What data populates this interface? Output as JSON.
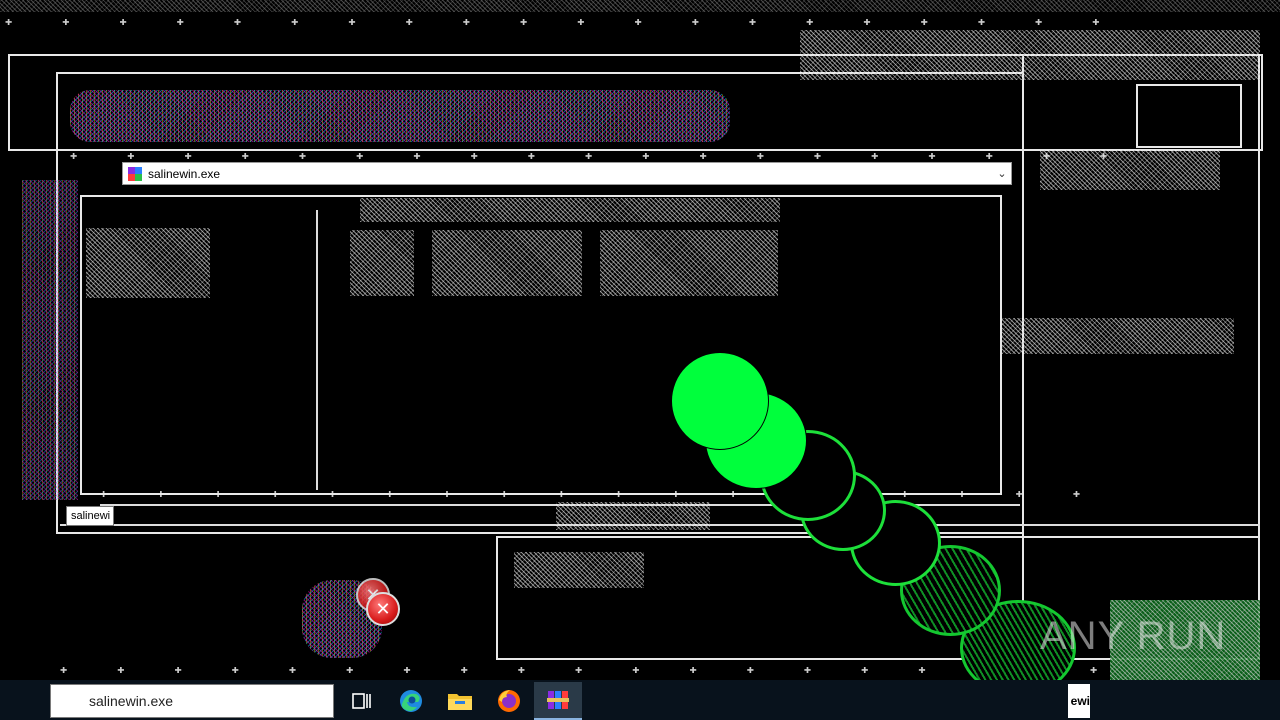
{
  "address_bar": {
    "path": "salinewin.exe"
  },
  "tooltip": {
    "text": "salinewi"
  },
  "taskbar": {
    "search_value": "salinewin.exe",
    "running_title_fragment": "ewi",
    "buttons": [
      {
        "icon": "task-view-icon"
      },
      {
        "icon": "edge-icon"
      },
      {
        "icon": "file-explorer-icon"
      },
      {
        "icon": "firefox-icon"
      },
      {
        "icon": "winrar-icon"
      }
    ]
  },
  "watermark": {
    "text": "ANY RUN"
  },
  "colors": {
    "trail_green": "#00ff3c",
    "taskbar_bg": "#08121c",
    "error_red": "#d81c1c"
  }
}
